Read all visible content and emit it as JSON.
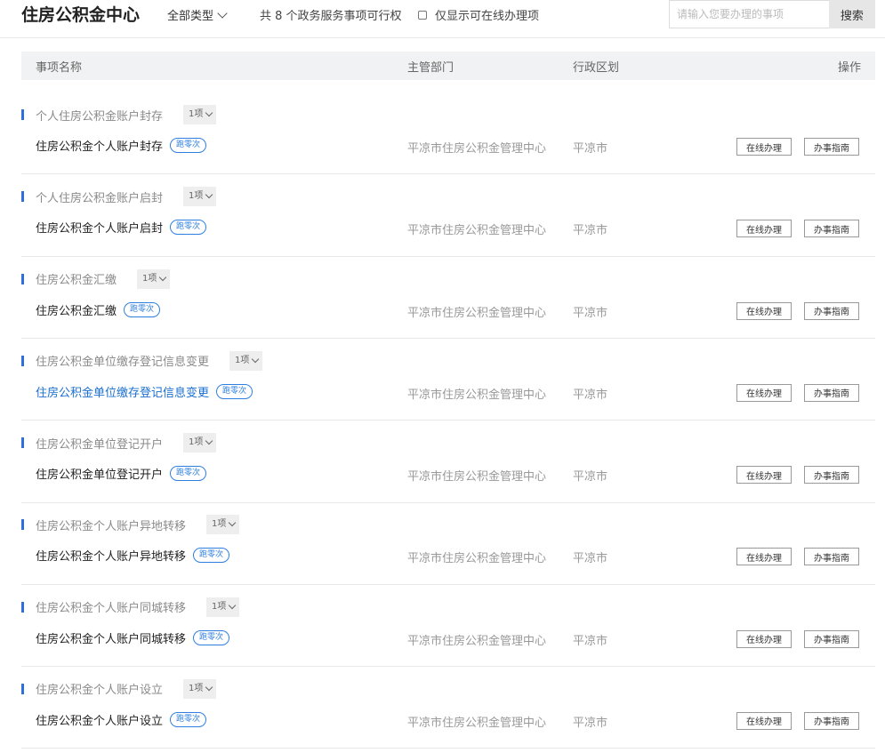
{
  "header": {
    "title": "住房公积金中心",
    "type_filter": "全部类型",
    "count_text": "共 8 个政务服务事项可行权",
    "online_only_label": "仅显示可在线办理项"
  },
  "search": {
    "placeholder": "请输入您要办理的事项",
    "button_label": "搜索"
  },
  "table": {
    "columns": {
      "name": "事项名称",
      "dept": "主管部门",
      "region": "行政区划",
      "ops": "操作"
    }
  },
  "colors": {
    "accent": "#2f6fdd",
    "link": "#1a6fd0"
  },
  "groups": [
    {
      "name": "个人住房公积金账户封存",
      "count": "1项",
      "item": "住房公积金个人账户封存",
      "badge": "跑零次",
      "dept": "平凉市住房公积金管理中心",
      "region": "平凉市",
      "online_btn": "在线办理",
      "guide_btn": "办事指南"
    },
    {
      "name": "个人住房公积金账户启封",
      "count": "1项",
      "item": "住房公积金个人账户启封",
      "badge": "跑零次",
      "dept": "平凉市住房公积金管理中心",
      "region": "平凉市",
      "online_btn": "在线办理",
      "guide_btn": "办事指南"
    },
    {
      "name": "住房公积金汇缴",
      "count": "1项",
      "item": "住房公积金汇缴",
      "badge": "跑零次",
      "dept": "平凉市住房公积金管理中心",
      "region": "平凉市",
      "online_btn": "在线办理",
      "guide_btn": "办事指南"
    },
    {
      "name": "住房公积金单位缴存登记信息变更",
      "count": "1项",
      "item": "住房公积金单位缴存登记信息变更",
      "badge": "跑零次",
      "dept": "平凉市住房公积金管理中心",
      "region": "平凉市",
      "online_btn": "在线办理",
      "guide_btn": "办事指南"
    },
    {
      "name": "住房公积金单位登记开户",
      "count": "1项",
      "item": "住房公积金单位登记开户",
      "badge": "跑零次",
      "dept": "平凉市住房公积金管理中心",
      "region": "平凉市",
      "online_btn": "在线办理",
      "guide_btn": "办事指南"
    },
    {
      "name": "住房公积金个人账户异地转移",
      "count": "1项",
      "item": "住房公积金个人账户异地转移",
      "badge": "跑零次",
      "dept": "平凉市住房公积金管理中心",
      "region": "平凉市",
      "online_btn": "在线办理",
      "guide_btn": "办事指南"
    },
    {
      "name": "住房公积金个人账户同城转移",
      "count": "1项",
      "item": "住房公积金个人账户同城转移",
      "badge": "跑零次",
      "dept": "平凉市住房公积金管理中心",
      "region": "平凉市",
      "online_btn": "在线办理",
      "guide_btn": "办事指南"
    },
    {
      "name": "住房公积金个人账户设立",
      "count": "1项",
      "item": "住房公积金个人账户设立",
      "badge": "跑零次",
      "dept": "平凉市住房公积金管理中心",
      "region": "平凉市",
      "online_btn": "在线办理",
      "guide_btn": "办事指南"
    }
  ]
}
